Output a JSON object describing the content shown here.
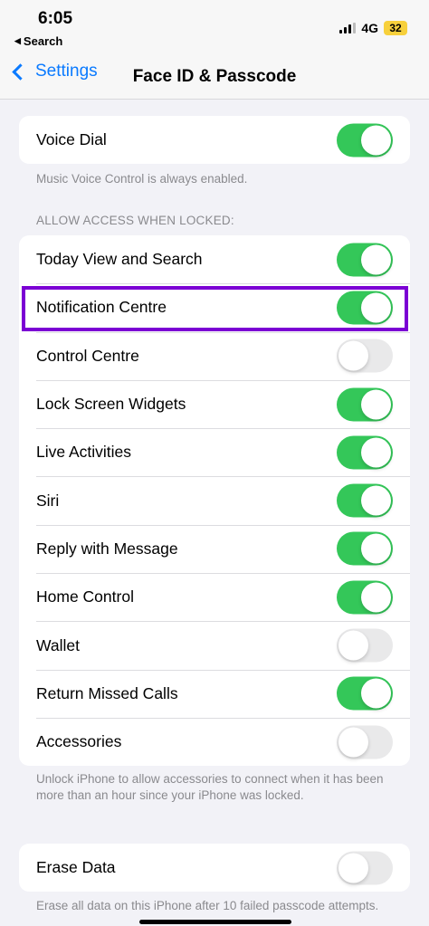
{
  "status": {
    "time": "6:05",
    "back_app": "Search",
    "network": "4G",
    "battery": "32"
  },
  "nav": {
    "back_label": "Settings",
    "title": "Face ID & Passcode"
  },
  "voice_dial": {
    "label": "Voice Dial",
    "on": true,
    "footer": "Music Voice Control is always enabled."
  },
  "locked_section": {
    "header": "ALLOW ACCESS WHEN LOCKED:",
    "items": [
      {
        "label": "Today View and Search",
        "on": true
      },
      {
        "label": "Notification Centre",
        "on": true
      },
      {
        "label": "Control Centre",
        "on": false
      },
      {
        "label": "Lock Screen Widgets",
        "on": true
      },
      {
        "label": "Live Activities",
        "on": true
      },
      {
        "label": "Siri",
        "on": true
      },
      {
        "label": "Reply with Message",
        "on": true
      },
      {
        "label": "Home Control",
        "on": true
      },
      {
        "label": "Wallet",
        "on": false
      },
      {
        "label": "Return Missed Calls",
        "on": true
      },
      {
        "label": "Accessories",
        "on": false
      }
    ],
    "footer": "Unlock iPhone to allow accessories to connect when it has been more than an hour since your iPhone was locked."
  },
  "erase": {
    "label": "Erase Data",
    "on": false,
    "footer": "Erase all data on this iPhone after 10 failed passcode attempts."
  },
  "colors": {
    "accent": "#0a7aff",
    "toggle_on": "#34c759",
    "highlight": "#7b00d4"
  }
}
